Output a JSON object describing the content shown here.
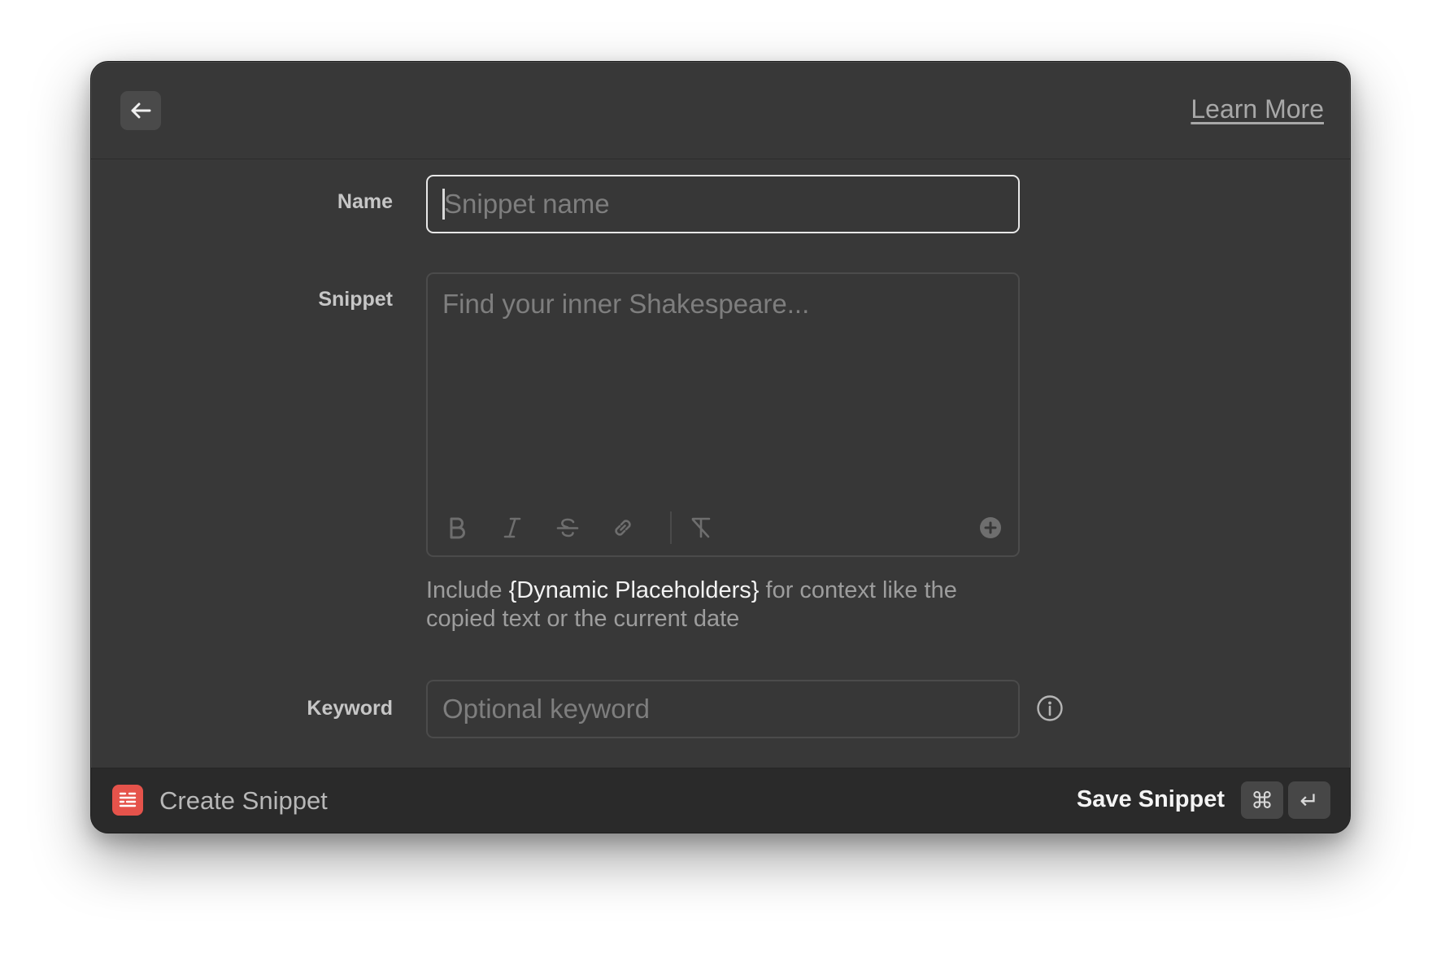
{
  "header": {
    "learn_more": "Learn More"
  },
  "form": {
    "name_label": "Name",
    "name_placeholder": "Snippet name",
    "snippet_label": "Snippet",
    "snippet_placeholder": "Find your inner Shakespeare...",
    "helper_prefix": "Include ",
    "helper_strong": "{Dynamic Placeholders}",
    "helper_suffix": " for context like the copied text or the current date",
    "keyword_label": "Keyword",
    "keyword_placeholder": "Optional keyword"
  },
  "toolbar": {
    "icons": [
      "bold-icon",
      "italic-icon",
      "strikethrough-icon",
      "link-icon",
      "clear-format-icon",
      "add-placeholder-icon"
    ]
  },
  "footer": {
    "title": "Create Snippet",
    "save_label": "Save Snippet",
    "shortcut_cmd": "⌘",
    "shortcut_enter": "↵"
  },
  "colors": {
    "window_bg": "#383838",
    "footer_bg": "#2a2a2a",
    "accent_app_icon": "#e5534b"
  }
}
